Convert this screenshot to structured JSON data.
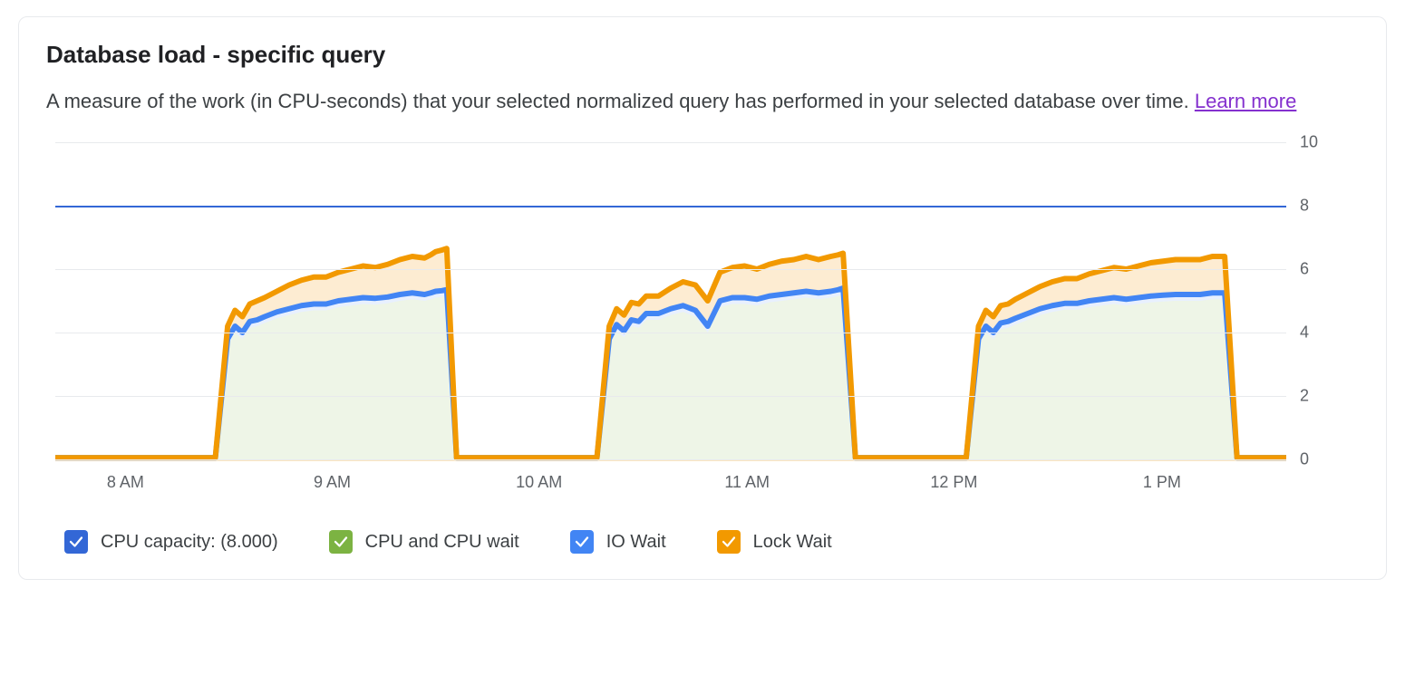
{
  "card": {
    "title": "Database load - specific query",
    "subtitle_lead": "A measure of the work (in CPU-seconds) that your selected normalized query has performed in your selected database over time. ",
    "learn_more": "Learn more"
  },
  "chart_data": {
    "type": "area",
    "ylim": [
      0,
      10
    ],
    "y_ticks": [
      0,
      2,
      4,
      6,
      8,
      10
    ],
    "x_ticks": [
      "8 AM",
      "9 AM",
      "10 AM",
      "11 AM",
      "12 PM",
      "1 PM"
    ],
    "x_tick_positions": [
      0.057,
      0.225,
      0.393,
      0.562,
      0.73,
      0.899
    ],
    "cpu_capacity": 8.0,
    "x": [
      0.0,
      0.13,
      0.14,
      0.146,
      0.152,
      0.158,
      0.164,
      0.17,
      0.18,
      0.19,
      0.2,
      0.21,
      0.22,
      0.23,
      0.24,
      0.25,
      0.26,
      0.27,
      0.28,
      0.29,
      0.3,
      0.305,
      0.309,
      0.314,
      0.318,
      0.326,
      0.44,
      0.45,
      0.456,
      0.462,
      0.468,
      0.474,
      0.48,
      0.49,
      0.5,
      0.51,
      0.52,
      0.53,
      0.54,
      0.55,
      0.56,
      0.57,
      0.58,
      0.59,
      0.6,
      0.61,
      0.62,
      0.63,
      0.636,
      0.64,
      0.65,
      0.74,
      0.75,
      0.756,
      0.762,
      0.768,
      0.774,
      0.78,
      0.79,
      0.8,
      0.81,
      0.82,
      0.83,
      0.84,
      0.85,
      0.86,
      0.87,
      0.88,
      0.89,
      0.9,
      0.91,
      0.92,
      0.93,
      0.94,
      0.946,
      0.95,
      0.96,
      1.0
    ],
    "series": [
      {
        "name": "CPU and CPU wait",
        "color": "#7cb342",
        "fill": "#eef5e7",
        "values": [
          0.05,
          0.05,
          3.6,
          4.0,
          3.8,
          4.15,
          4.2,
          4.3,
          4.45,
          4.55,
          4.65,
          4.7,
          4.7,
          4.8,
          4.85,
          4.9,
          4.88,
          4.92,
          5.0,
          5.05,
          5.0,
          5.05,
          5.1,
          5.12,
          5.15,
          0.05,
          0.05,
          3.6,
          4.05,
          3.85,
          4.2,
          4.15,
          4.4,
          4.4,
          4.55,
          4.65,
          4.5,
          4.0,
          4.8,
          4.9,
          4.9,
          4.85,
          4.95,
          5.0,
          5.05,
          5.1,
          5.05,
          5.1,
          5.15,
          5.2,
          0.05,
          0.05,
          3.6,
          4.0,
          3.8,
          4.1,
          4.15,
          4.25,
          4.4,
          4.55,
          4.65,
          4.72,
          4.72,
          4.8,
          4.85,
          4.9,
          4.85,
          4.9,
          4.95,
          4.98,
          5.0,
          5.0,
          5.0,
          5.05,
          5.05,
          5.05,
          0.05,
          0.05
        ]
      },
      {
        "name": "IO Wait",
        "color": "#4285f4",
        "fill": "#e8f0fe",
        "values": [
          0.05,
          0.05,
          3.8,
          4.2,
          4.0,
          4.35,
          4.4,
          4.5,
          4.65,
          4.75,
          4.85,
          4.9,
          4.9,
          5.0,
          5.05,
          5.1,
          5.08,
          5.12,
          5.2,
          5.25,
          5.2,
          5.25,
          5.3,
          5.32,
          5.35,
          0.05,
          0.05,
          3.8,
          4.25,
          4.05,
          4.4,
          4.35,
          4.6,
          4.6,
          4.75,
          4.85,
          4.7,
          4.2,
          5.0,
          5.1,
          5.1,
          5.05,
          5.15,
          5.2,
          5.25,
          5.3,
          5.25,
          5.3,
          5.35,
          5.4,
          0.05,
          0.05,
          3.8,
          4.2,
          4.0,
          4.3,
          4.35,
          4.45,
          4.6,
          4.75,
          4.85,
          4.92,
          4.92,
          5.0,
          5.05,
          5.1,
          5.05,
          5.1,
          5.15,
          5.18,
          5.2,
          5.2,
          5.2,
          5.25,
          5.25,
          5.25,
          0.05,
          0.05
        ]
      },
      {
        "name": "Lock Wait",
        "color": "#f29900",
        "fill": "#fdecd2",
        "values": [
          0.05,
          0.05,
          4.2,
          4.7,
          4.5,
          4.9,
          5.0,
          5.1,
          5.3,
          5.5,
          5.65,
          5.75,
          5.75,
          5.9,
          6.0,
          6.1,
          6.05,
          6.15,
          6.3,
          6.4,
          6.35,
          6.45,
          6.55,
          6.6,
          6.65,
          0.05,
          0.05,
          4.2,
          4.75,
          4.55,
          4.95,
          4.9,
          5.15,
          5.15,
          5.4,
          5.6,
          5.5,
          5.0,
          5.9,
          6.05,
          6.1,
          6.0,
          6.15,
          6.25,
          6.3,
          6.4,
          6.3,
          6.4,
          6.45,
          6.5,
          0.05,
          0.05,
          4.2,
          4.7,
          4.5,
          4.85,
          4.9,
          5.05,
          5.25,
          5.45,
          5.6,
          5.7,
          5.7,
          5.85,
          5.95,
          6.05,
          6.0,
          6.1,
          6.2,
          6.25,
          6.3,
          6.3,
          6.3,
          6.4,
          6.4,
          6.4,
          0.05,
          0.05
        ]
      }
    ]
  },
  "legend": {
    "items": [
      {
        "key": "cpu_capacity",
        "label": "CPU capacity: (8.000)",
        "color": "#3367d6"
      },
      {
        "key": "cpu_wait",
        "label": "CPU and CPU wait",
        "color": "#7cb342"
      },
      {
        "key": "io_wait",
        "label": "IO Wait",
        "color": "#4285f4"
      },
      {
        "key": "lock_wait",
        "label": "Lock Wait",
        "color": "#f29900"
      }
    ]
  }
}
